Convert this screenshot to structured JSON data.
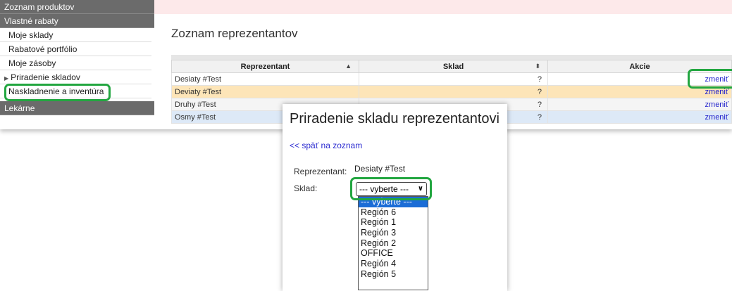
{
  "sidebar": {
    "headers": [
      "Zoznam produktov",
      "Vlastné rabaty",
      "Lekárne"
    ],
    "items": [
      "Moje sklady",
      "Rabatové portfólio",
      "Moje zásoby",
      "Priradenie skladov",
      "Naskladnenie a inventúra"
    ]
  },
  "main": {
    "title": "Zoznam reprezentantov",
    "columns": [
      "Reprezentant",
      "Sklad",
      "Akcie"
    ],
    "rows": [
      {
        "name": "Desiaty #Test",
        "sklad": "?",
        "action": "zmeniť"
      },
      {
        "name": "Deviaty #Test",
        "sklad": "?",
        "action": "zmeniť"
      },
      {
        "name": "Druhy #Test",
        "sklad": "?",
        "action": "zmeniť"
      },
      {
        "name": "Osmy #Test",
        "sklad": "?",
        "action": "zmeniť"
      }
    ]
  },
  "modal": {
    "title": "Priradenie skladu reprezentantovi",
    "back_link": "<< späť na zoznam",
    "rep_label": "Reprezentant:",
    "rep_value": "Desiaty #Test",
    "sklad_label": "Sklad:",
    "select_value": "--- vyberte ---",
    "options": [
      "--- vyberte ---",
      "Región 6",
      "Región 1",
      "Región 3",
      "Región 2",
      "OFFICE",
      "Región 4",
      "Región 5"
    ]
  },
  "colors": {
    "highlight": "#22a640",
    "sidebar_header": "#6b6b6b",
    "link": "#2222cc",
    "row_alt": "#fde5b8",
    "row_blue": "#dde9f7",
    "selected_option": "#1b6cd6"
  },
  "icons": {
    "sort_asc": "triangle-up-icon",
    "sort_both": "sort-icon",
    "submenu": "triangle-right-icon",
    "select_chevron": "chevron-down-icon"
  }
}
